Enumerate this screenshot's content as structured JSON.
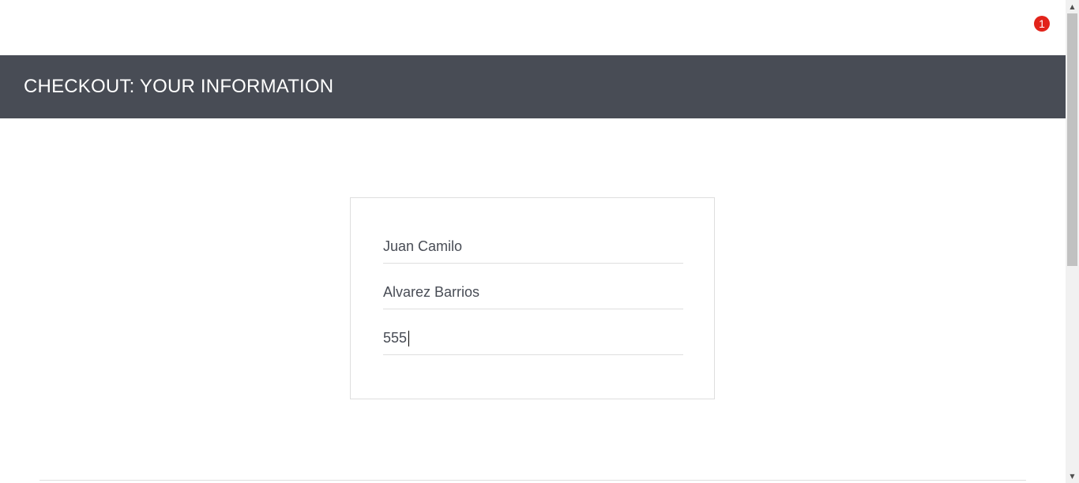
{
  "header": {
    "title": "CHECKOUT: YOUR INFORMATION"
  },
  "cart": {
    "icon": "shopping-cart-icon",
    "badge_count": "1",
    "badge_color": "#e2231a"
  },
  "form": {
    "first_name": "Juan Camilo",
    "last_name": "Alvarez Barrios",
    "postal_code": "555"
  },
  "colors": {
    "header_bg": "#484c55",
    "field_text": "#484c55",
    "border": "#dedede"
  },
  "scrollbar": {
    "up_arrow_icon": "scroll-up-arrow-icon",
    "down_arrow_icon": "scroll-down-arrow-icon"
  }
}
